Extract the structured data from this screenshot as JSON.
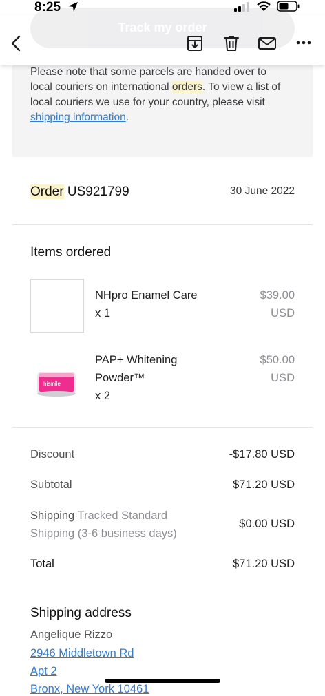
{
  "status_bar": {
    "time": "8:25"
  },
  "header": {
    "ghost_button_label": "Track my order"
  },
  "notice": {
    "line1": "Please note that some parcels are handed over to",
    "line2a": "local couriers on international ",
    "line2_highlight": "orders",
    "line2b": ". To view a list of",
    "line3": "local couriers we use for your country, please visit",
    "link": "shipping information",
    "link_suffix": "."
  },
  "order": {
    "label": "Order",
    "number": "US921799",
    "date": "30 June 2022"
  },
  "items_section": {
    "title": "Items ordered",
    "items": [
      {
        "name": "NHpro Enamel Care",
        "qty": "x 1",
        "price": "$39.00",
        "currency": "USD",
        "thumb_label": ""
      },
      {
        "name_line1": "PAP+ Whitening",
        "name_line2": "Powder™",
        "qty": "x 2",
        "price": "$50.00",
        "currency": "USD",
        "thumb_label": "hismile"
      }
    ]
  },
  "totals": {
    "discount_label": "Discount",
    "discount_value": "-$17.80 USD",
    "subtotal_label": "Subtotal",
    "subtotal_value": "$71.20 USD",
    "shipping_label": "Shipping",
    "shipping_method_1": "Tracked Standard",
    "shipping_method_2": "Shipping (3-6 business days)",
    "shipping_value": "$0.00 USD",
    "total_label": "Total",
    "total_value": "$71.20 USD"
  },
  "shipping_address": {
    "title": "Shipping address",
    "name": "Angelique Rizzo",
    "line1": "2946 Middletown Rd ",
    "line2": "Apt 2 ",
    "line3": "Bronx, New York 10461"
  },
  "colors": {
    "link": "#2f7bd6",
    "highlight": "#fbf3c9",
    "panel": "#f4f4f5"
  },
  "icons": [
    "location-arrow-icon",
    "signal-icon",
    "wifi-icon",
    "battery-icon",
    "back-chevron-icon",
    "archive-icon",
    "trash-icon",
    "mail-icon",
    "more-icon"
  ]
}
